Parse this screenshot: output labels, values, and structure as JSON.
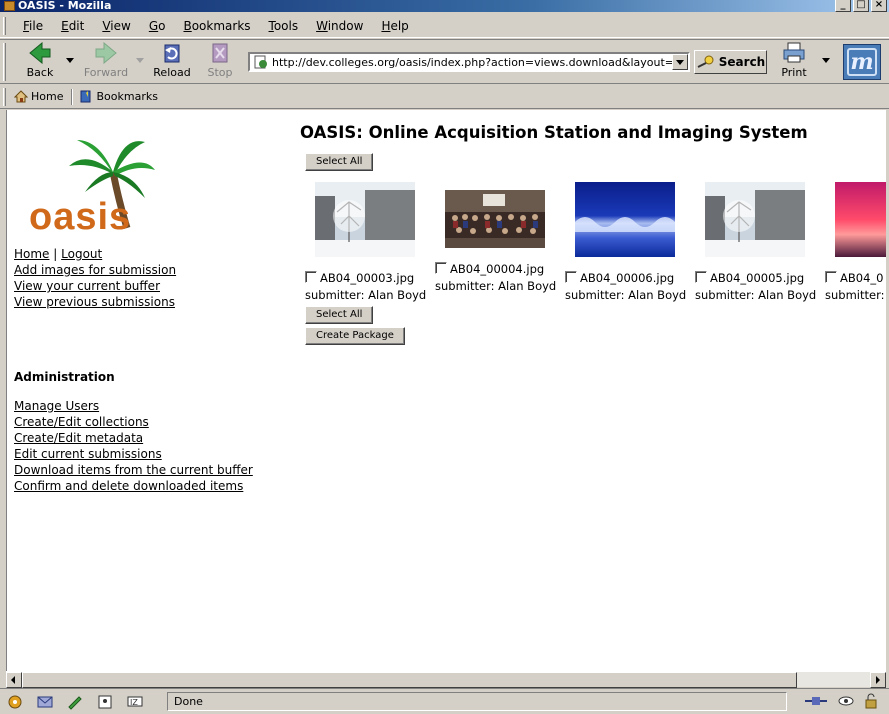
{
  "window": {
    "title": "OASIS - Mozilla"
  },
  "menu": {
    "items": [
      {
        "label": "File",
        "accel": "F",
        "rest": "ile"
      },
      {
        "label": "Edit",
        "accel": "E",
        "rest": "dit"
      },
      {
        "label": "View",
        "accel": "V",
        "rest": "iew"
      },
      {
        "label": "Go",
        "accel": "G",
        "rest": "o"
      },
      {
        "label": "Bookmarks",
        "accel": "B",
        "rest": "ookmarks"
      },
      {
        "label": "Tools",
        "accel": "T",
        "rest": "ools"
      },
      {
        "label": "Window",
        "accel": "W",
        "rest": "indow"
      },
      {
        "label": "Help",
        "accel": "H",
        "rest": "elp"
      }
    ]
  },
  "navbar": {
    "back": "Back",
    "forward": "Forward",
    "reload": "Reload",
    "stop": "Stop",
    "url": "http://dev.colleges.org/oasis/index.php?action=views.download&layout=administ",
    "search": "Search",
    "print": "Print"
  },
  "personal_bar": {
    "home": "Home",
    "bookmarks": "Bookmarks"
  },
  "sidebar": {
    "logo_text": "oasis",
    "home": "Home",
    "separator": "|",
    "logout": "Logout",
    "links": [
      "Add images for submission",
      "View your current buffer",
      "View previous submissions"
    ],
    "admin_heading": "Administration",
    "admin_links": [
      "Manage Users",
      "Create/Edit collections",
      "Create/Edit metadata",
      "Edit current submissions",
      "Download items from the current buffer",
      "Confirm and delete downloaded items"
    ]
  },
  "main": {
    "title": "OASIS: Online Acquisition Station and Imaging System",
    "select_all_top": "Select All",
    "select_all_bottom": "Select All",
    "create_package": "Create Package",
    "thumbnails": [
      {
        "filename": "AB04_00003.jpg",
        "submitter": "submitter: Alan Boyd",
        "checked": false
      },
      {
        "filename": "AB04_00004.jpg",
        "submitter": "submitter: Alan Boyd",
        "checked": false
      },
      {
        "filename": "AB04_00006.jpg",
        "submitter": "submitter: Alan Boyd",
        "checked": false
      },
      {
        "filename": "AB04_00005.jpg",
        "submitter": "submitter: Alan Boyd",
        "checked": false
      },
      {
        "filename": "AB04_0",
        "submitter": "submitter: A",
        "checked": false
      }
    ]
  },
  "status": {
    "text": "Done"
  }
}
